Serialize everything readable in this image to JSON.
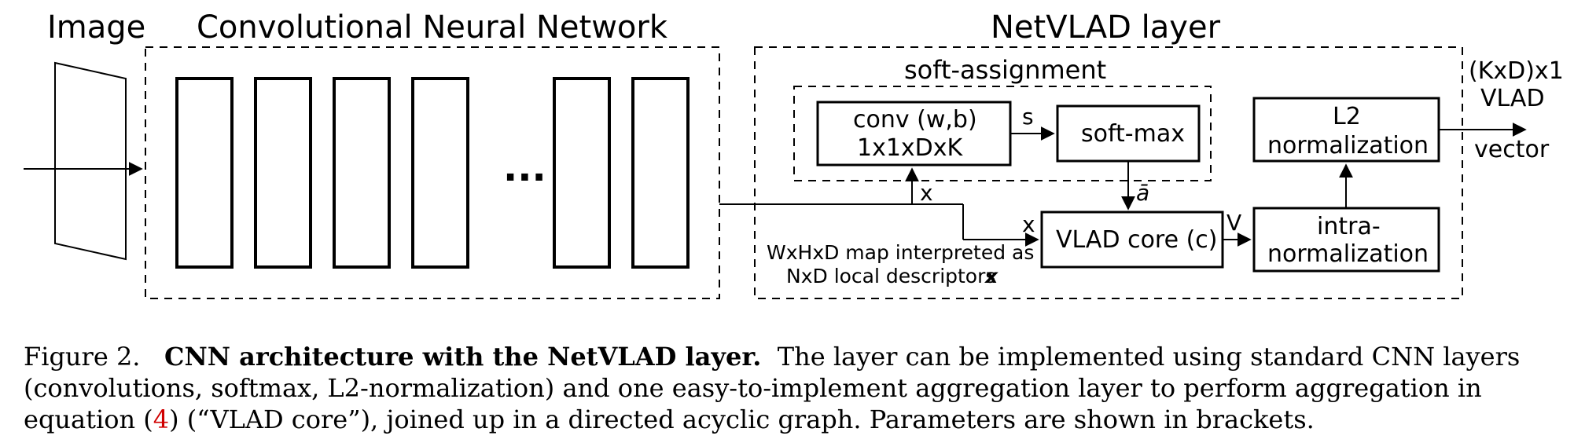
{
  "labels": {
    "image": "Image",
    "cnn": "Convolutional Neural Network",
    "netvlad": "NetVLAD layer",
    "soft_assignment": "soft-assignment",
    "conv_line1": "conv (w,b)",
    "conv_line2": "1x1xDxK",
    "softmax": "soft-max",
    "l2norm": "L2",
    "l2norm2": "normalization",
    "vladcore": "VLAD core (c)",
    "intra1": "intra-",
    "intra2": "normalization",
    "map1": "WxHxD map interpreted as",
    "map2": "NxD local descriptors",
    "x1": "x",
    "x2": "x",
    "s": "s",
    "abar": "ā",
    "V": "V",
    "out1": "(KxD)x1",
    "out2": "VLAD",
    "out3": "vector",
    "ellipsis": "..."
  },
  "caption": {
    "prefix": "Figure 2.",
    "title": "CNN architecture with the NetVLAD layer.",
    "body1": "The layer can be implemented using standard CNN layers (convolutions, softmax, L2-normalization) and one easy-to-implement aggregation layer to perform aggregation in equation (",
    "eqnum": "4",
    "body2": ") (“VLAD core”), joined up in a directed acyclic graph. Parameters are shown in brackets."
  }
}
